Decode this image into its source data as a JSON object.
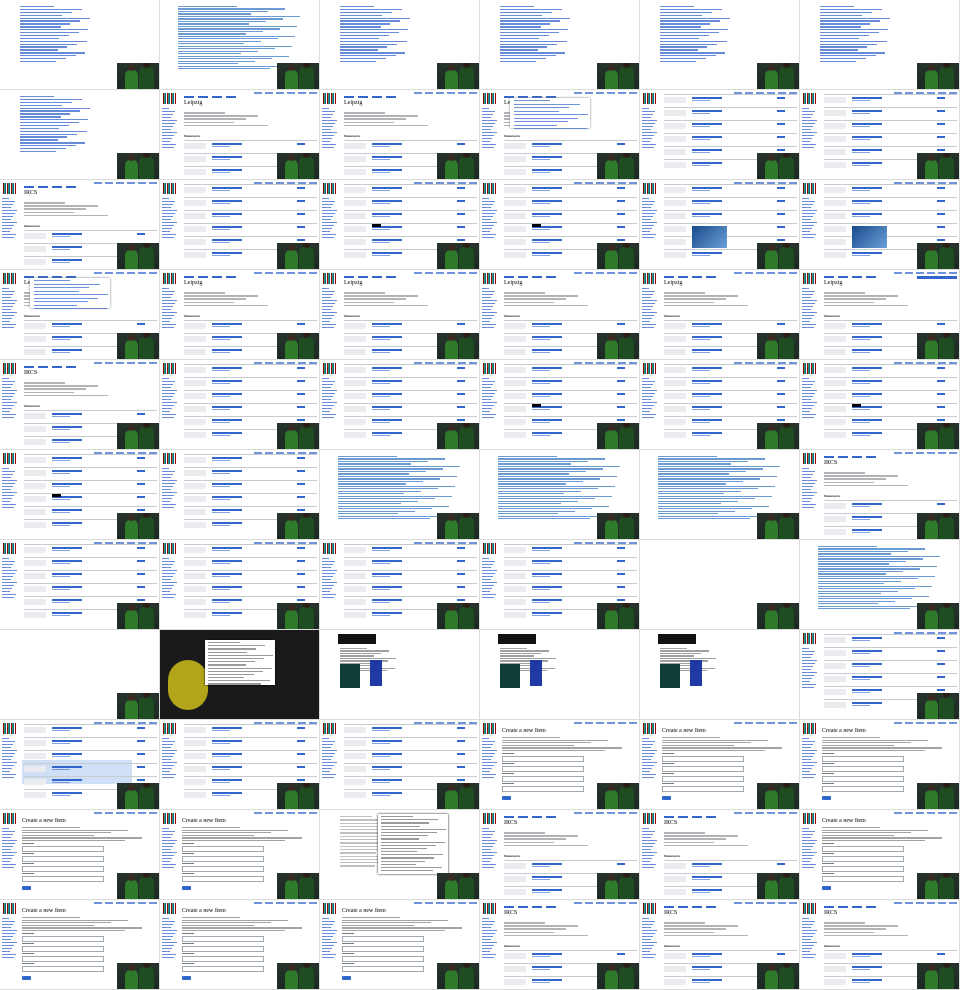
{
  "screenshot": {
    "grid": {
      "columns": 6,
      "rows": 11
    },
    "item_title": "Leipzig",
    "item_title_alt": "IRCS",
    "create_form_title": "Create a new Item",
    "statements_heading": "Statements",
    "cells": [
      {
        "kind": "link-list"
      },
      {
        "kind": "diff-list"
      },
      {
        "kind": "link-list"
      },
      {
        "kind": "link-list"
      },
      {
        "kind": "link-list"
      },
      {
        "kind": "link-list"
      },
      {
        "kind": "link-list"
      },
      {
        "kind": "item",
        "title": "Leipzig"
      },
      {
        "kind": "item",
        "title": "Leipzig"
      },
      {
        "kind": "item-dropdown",
        "title": "Leipzig"
      },
      {
        "kind": "statements"
      },
      {
        "kind": "statements"
      },
      {
        "kind": "item-small",
        "title": "IRCS"
      },
      {
        "kind": "statements"
      },
      {
        "kind": "statements-tooltip"
      },
      {
        "kind": "statements-tooltip"
      },
      {
        "kind": "statements-image"
      },
      {
        "kind": "statements-image"
      },
      {
        "kind": "item-dropdown",
        "title": "Leipzig"
      },
      {
        "kind": "item",
        "title": "Leipzig"
      },
      {
        "kind": "item",
        "title": "Leipzig"
      },
      {
        "kind": "item",
        "title": "Leipzig"
      },
      {
        "kind": "item",
        "title": "Leipzig"
      },
      {
        "kind": "item-selbar",
        "title": "Leipzig"
      },
      {
        "kind": "item-small",
        "title": "IRCS"
      },
      {
        "kind": "statements"
      },
      {
        "kind": "statements"
      },
      {
        "kind": "statements-tooltip"
      },
      {
        "kind": "statements"
      },
      {
        "kind": "statements-tooltip"
      },
      {
        "kind": "statements-tooltip"
      },
      {
        "kind": "statements"
      },
      {
        "kind": "diff-list"
      },
      {
        "kind": "diff-list"
      },
      {
        "kind": "diff-list"
      },
      {
        "kind": "item-small",
        "title": "IRCS"
      },
      {
        "kind": "statements"
      },
      {
        "kind": "statements"
      },
      {
        "kind": "statements"
      },
      {
        "kind": "statements"
      },
      {
        "kind": "blank"
      },
      {
        "kind": "search-results"
      },
      {
        "kind": "blank"
      },
      {
        "kind": "photo-dialog"
      },
      {
        "kind": "website"
      },
      {
        "kind": "website"
      },
      {
        "kind": "website"
      },
      {
        "kind": "statements"
      },
      {
        "kind": "statements-highlight"
      },
      {
        "kind": "statements"
      },
      {
        "kind": "statements"
      },
      {
        "kind": "create-form",
        "title": "Create a new Item"
      },
      {
        "kind": "create-form",
        "title": "Create a new Item"
      },
      {
        "kind": "create-form",
        "title": "Create a new Item"
      },
      {
        "kind": "create-form",
        "title": "Create a new Item"
      },
      {
        "kind": "create-form",
        "title": "Create a new Item"
      },
      {
        "kind": "social-feed"
      },
      {
        "kind": "item-small",
        "title": "IRCS"
      },
      {
        "kind": "item-small",
        "title": "IRCS"
      },
      {
        "kind": "create-form",
        "title": "Create a new Item"
      },
      {
        "kind": "create-form",
        "title": "Create a new Item"
      },
      {
        "kind": "create-form",
        "title": "Create a new Item"
      },
      {
        "kind": "create-form",
        "title": "Create a new Item"
      },
      {
        "kind": "item-small",
        "title": "IRCS"
      },
      {
        "kind": "item-small",
        "title": "IRCS"
      },
      {
        "kind": "item-small",
        "title": "IRCS"
      }
    ]
  }
}
